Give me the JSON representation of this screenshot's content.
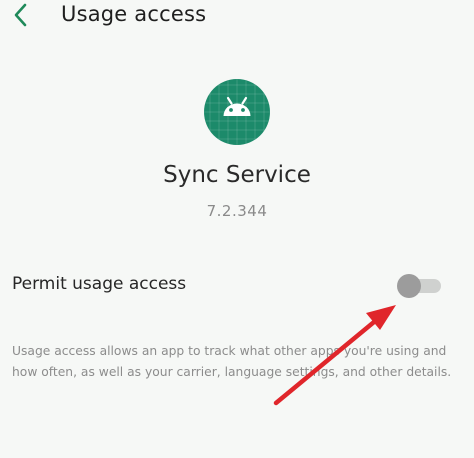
{
  "header": {
    "title": "Usage access",
    "back_icon": "chevron-left-icon",
    "accent_color": "#1f8a5a"
  },
  "app": {
    "icon": "android-icon",
    "icon_color": "#1c8a6a",
    "name": "Sync Service",
    "version": "7.2.344"
  },
  "permission": {
    "label": "Permit usage access",
    "enabled": false,
    "description": "Usage access allows an app to track what other apps you're using and how often, as well as your carrier, language settings, and other details."
  },
  "annotation": {
    "icon": "red-arrow-icon",
    "color": "#e0262b"
  }
}
